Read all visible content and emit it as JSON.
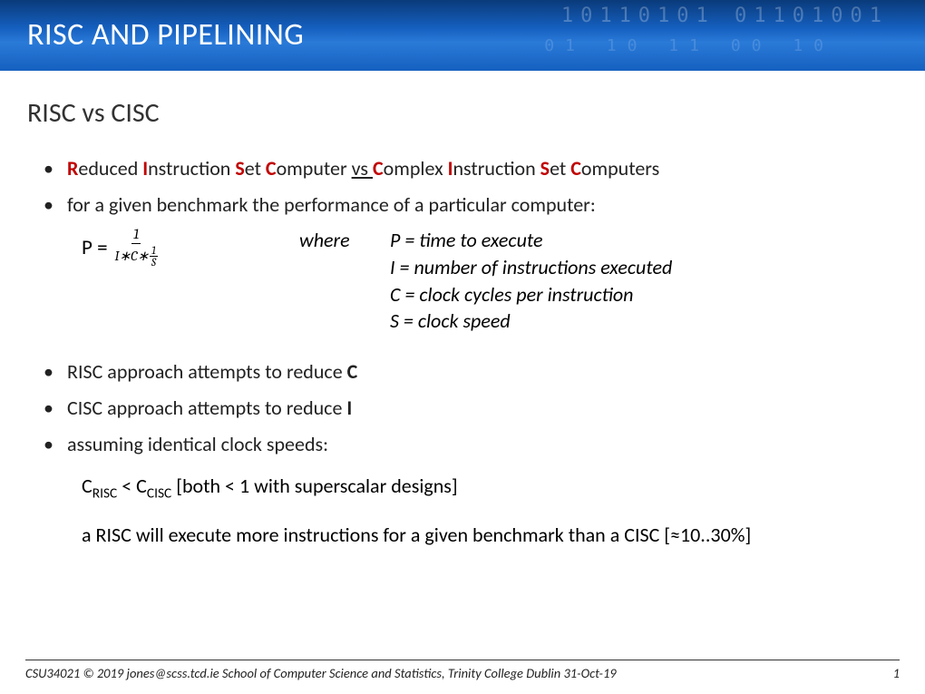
{
  "header": {
    "title": "RISC AND PIPELINING"
  },
  "subtitle": "RISC vs CISC",
  "bullet1": {
    "r1": "R",
    "t1": "educed ",
    "i1": "I",
    "t2": "nstruction ",
    "s1": "S",
    "t3": "et ",
    "c1": "C",
    "t4": "omputer ",
    "vs": "vs ",
    "c2": "C",
    "t5": "omplex ",
    "i2": "I",
    "t6": "nstruction ",
    "s2": "S",
    "t7": "et ",
    "c3": "C",
    "t8": "omputers"
  },
  "bullet2": "for a given benchmark the performance of a particular computer:",
  "formula": {
    "lhs": "P =",
    "num_top": "1",
    "denom_i": "I",
    "denom_c": "C",
    "denom_star": "∗",
    "mini_top": "1",
    "mini_bot": "S"
  },
  "where": {
    "label": "where",
    "p": "P = time to execute",
    "i": "I = number of instructions executed",
    "c": "C = clock cycles per instruction",
    "s": "S = clock speed"
  },
  "bullet3": {
    "pre": "RISC approach attempts to reduce ",
    "bold": "C"
  },
  "bullet4": {
    "pre": "CISC approach attempts to reduce ",
    "bold": "I"
  },
  "bullet5": "assuming identical clock speeds:",
  "ineq": {
    "c_pre": "C",
    "risc": "RISC",
    "lt": " <  ",
    "c_pre2": "C",
    "cisc": "CISC",
    "rest": "  [both < 1 with superscalar designs]"
  },
  "conclusion": "a RISC will execute more instructions for a given benchmark than a CISC [≈10..30%]",
  "footer": {
    "left": "CSU34021 © 2019 jones@scss.tcd.ie School of Computer Science and Statistics, Trinity College Dublin  31-Oct-19",
    "page": "1"
  }
}
